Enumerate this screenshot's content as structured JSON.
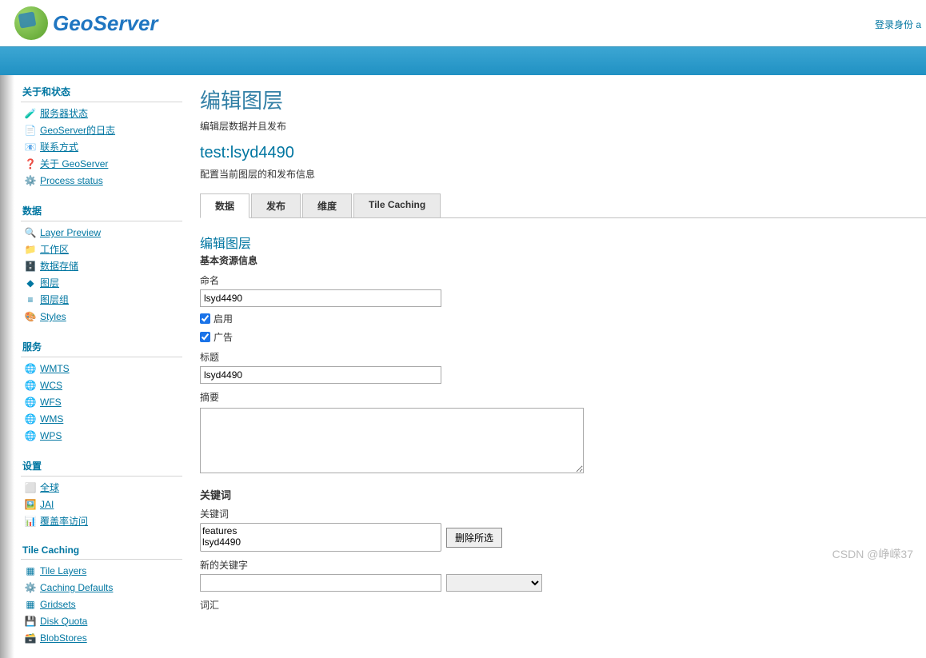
{
  "header": {
    "logo_text": "GeoServer",
    "login_text": "登录身份 a"
  },
  "sidebar": {
    "sections": [
      {
        "title": "关于和状态",
        "items": [
          {
            "icon": "🧪",
            "label": "服务器状态",
            "link": true
          },
          {
            "icon": "📄",
            "label": "GeoServer的日志",
            "link": true
          },
          {
            "icon": "📧",
            "label": "联系方式",
            "link": true
          },
          {
            "icon": "❓",
            "label": "关于 GeoServer",
            "link": true
          },
          {
            "icon": "⚙️",
            "label": "Process status",
            "link": true
          }
        ]
      },
      {
        "title": "数据",
        "items": [
          {
            "icon": "🔍",
            "label": "Layer Preview",
            "link": true
          },
          {
            "icon": "📁",
            "label": "工作区",
            "link": true
          },
          {
            "icon": "🗄️",
            "label": "数据存储",
            "link": true
          },
          {
            "icon": "◆",
            "label": "图层",
            "link": true
          },
          {
            "icon": "≡",
            "label": "图层组",
            "link": true
          },
          {
            "icon": "🎨",
            "label": "Styles",
            "link": true
          }
        ]
      },
      {
        "title": "服务",
        "items": [
          {
            "icon": "🌐",
            "label": "WMTS",
            "link": true
          },
          {
            "icon": "🌐",
            "label": "WCS",
            "link": true
          },
          {
            "icon": "🌐",
            "label": "WFS",
            "link": true
          },
          {
            "icon": "🌐",
            "label": "WMS",
            "link": true
          },
          {
            "icon": "🌐",
            "label": "WPS",
            "link": true
          }
        ]
      },
      {
        "title": "设置",
        "items": [
          {
            "icon": "⬜",
            "label": "全球",
            "link": true
          },
          {
            "icon": "🖼️",
            "label": "JAI",
            "link": true
          },
          {
            "icon": "📊",
            "label": "覆盖率访问",
            "link": true
          }
        ]
      },
      {
        "title": "Tile Caching",
        "items": [
          {
            "icon": "▦",
            "label": "Tile Layers",
            "link": true
          },
          {
            "icon": "⚙️",
            "label": "Caching Defaults",
            "link": true
          },
          {
            "icon": "▦",
            "label": "Gridsets",
            "link": true
          },
          {
            "icon": "💾",
            "label": "Disk Quota",
            "link": true
          },
          {
            "icon": "🗃️",
            "label": "BlobStores",
            "link": true
          }
        ]
      }
    ]
  },
  "main": {
    "page_title": "编辑图层",
    "page_desc": "编辑层数据并且发布",
    "layer_name": "test:lsyd4490",
    "layer_desc": "配置当前图层的和发布信息",
    "tabs": [
      {
        "label": "数据",
        "active": true
      },
      {
        "label": "发布",
        "active": false
      },
      {
        "label": "维度",
        "active": false
      },
      {
        "label": "Tile Caching",
        "active": false
      }
    ],
    "form": {
      "section_title": "编辑图层",
      "section_subtitle": "基本资源信息",
      "name_label": "命名",
      "name_value": "lsyd4490",
      "enable_label": "启用",
      "advert_label": "广告",
      "title_label": "标题",
      "title_value": "lsyd4490",
      "abstract_label": "摘要",
      "keywords_title": "关键词",
      "keyword_label": "关键词",
      "keyword_options": [
        "features",
        "lsyd4490"
      ],
      "delete_btn": "删除所选",
      "new_keyword_label": "新的关键字",
      "vocab_label": "词汇"
    }
  },
  "watermark": "CSDN @峥嵘37"
}
